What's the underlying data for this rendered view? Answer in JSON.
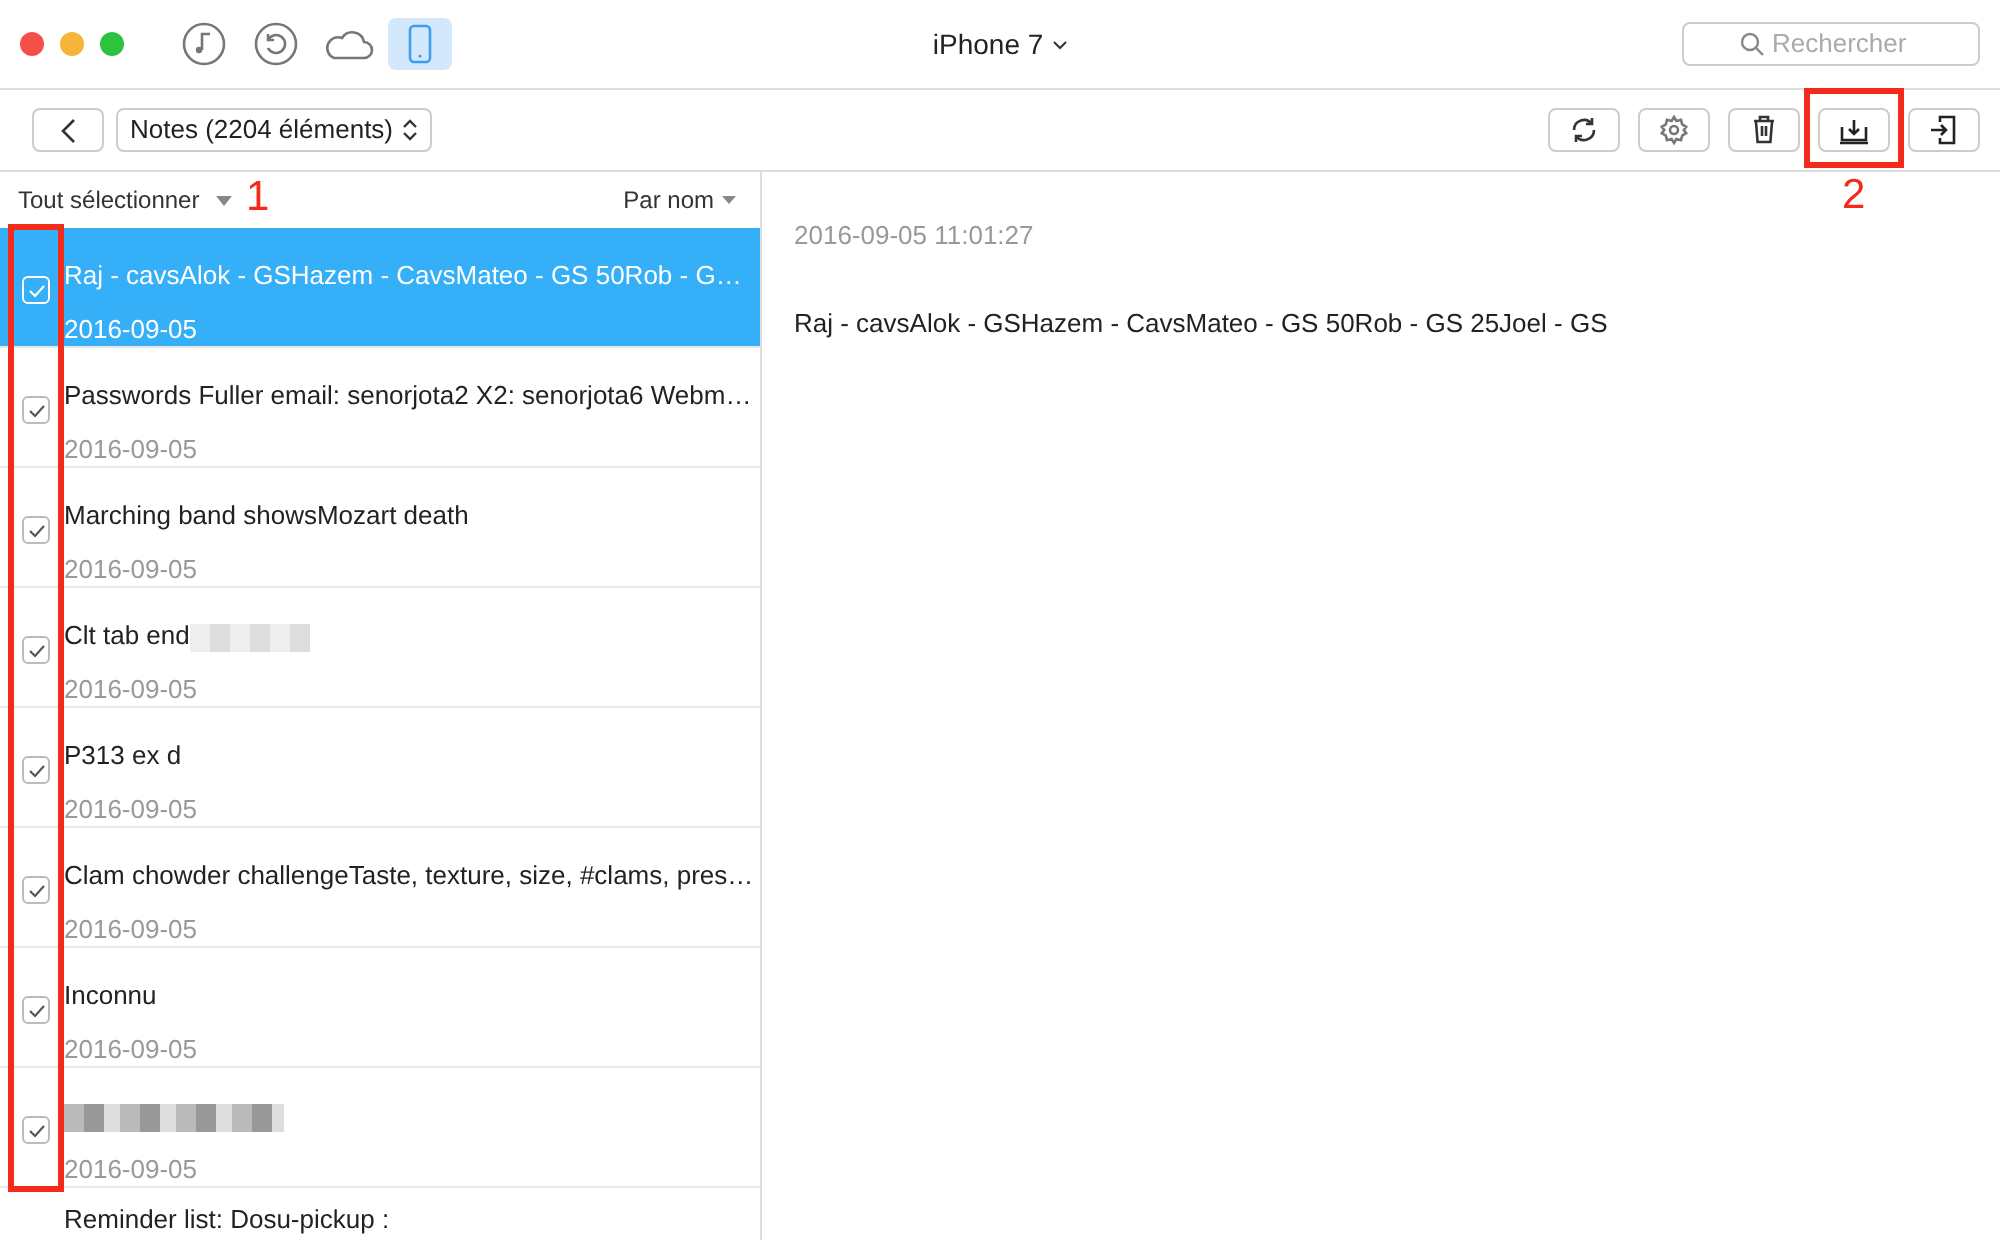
{
  "window": {
    "device_title": "iPhone 7",
    "search": {
      "placeholder": "Rechercher"
    }
  },
  "top_icons": [
    {
      "kind": "music",
      "selected": false
    },
    {
      "kind": "restore",
      "selected": false
    },
    {
      "kind": "cloud",
      "selected": false
    },
    {
      "kind": "phone",
      "selected": true
    }
  ],
  "toolbar": {
    "category": "Notes (2204 éléments)",
    "buttons": [
      {
        "kind": "refresh"
      },
      {
        "kind": "settings"
      },
      {
        "kind": "delete"
      },
      {
        "kind": "export"
      },
      {
        "kind": "import"
      }
    ]
  },
  "list_header": {
    "select_all": "Tout sélectionner",
    "sort": "Par nom"
  },
  "notes": [
    {
      "kind": "text",
      "title": "Raj - cavsAlok - GSHazem - CavsMateo - GS 50Rob - G…",
      "date": "2016-09-05",
      "checked": true,
      "selected": true
    },
    {
      "kind": "text",
      "title": "Passwords Fuller email: senorjota2 X2: senorjota6 Webm…",
      "date": "2016-09-05",
      "checked": true,
      "selected": false
    },
    {
      "kind": "text",
      "title": "Marching band showsMozart death",
      "date": "2016-09-05",
      "checked": true,
      "selected": false
    },
    {
      "kind": "partly_redacted",
      "title": "Clt tab end",
      "date": "2016-09-05",
      "checked": true,
      "selected": false
    },
    {
      "kind": "text",
      "title": "P313 ex d",
      "date": "2016-09-05",
      "checked": true,
      "selected": false
    },
    {
      "kind": "text",
      "title": "Clam chowder challengeTaste, texture, size, #clams, pres…",
      "date": "2016-09-05",
      "checked": true,
      "selected": false
    },
    {
      "kind": "text",
      "title": "Inconnu",
      "date": "2016-09-05",
      "checked": true,
      "selected": false
    },
    {
      "kind": "redacted",
      "date": "2016-09-05",
      "checked": true,
      "selected": false
    },
    {
      "kind": "text",
      "title": "Reminder list: Dosu-pickup :",
      "selected": false
    }
  ],
  "detail": {
    "timestamp": "2016-09-05 11:01:27",
    "body": "Raj - cavsAlok - GSHazem - CavsMateo - GS 50Rob - GS 25Joel - GS"
  },
  "annotations": [
    {
      "label": "1",
      "kind": "checkboxes"
    },
    {
      "label": "2",
      "kind": "export"
    }
  ]
}
